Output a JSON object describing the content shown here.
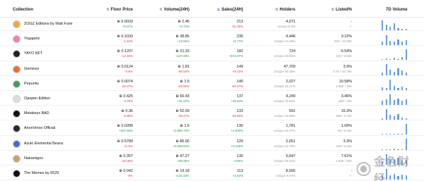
{
  "header": {
    "collection": "Collection",
    "floor_price": "Floor Price",
    "volume": "Volume(24H)",
    "sales": "Sales(24H)",
    "holders": "Holders",
    "listed": "Listed%",
    "volume_7d": "7D Volume"
  },
  "rows": [
    {
      "name": "ZOGZ Editions by Matt Furie",
      "avatar_color": "#f2a93b",
      "floor": "⊕ 0.0033",
      "floor_change": "+9.67%",
      "floor_dir": "up",
      "volume": "⊕ 2.45",
      "volume_change": "+2.74%",
      "volume_dir": "up",
      "sales": "213",
      "sales_change": "-51.49%",
      "sales_dir": "down",
      "holders": "4,071",
      "holders_sub": "Unique 6.3%",
      "listed": "-",
      "listed_sub": "-/-",
      "spark": [
        0.9,
        0.5,
        0.3,
        0.6,
        0.2,
        0.15,
        0.1
      ]
    },
    {
      "name": "Yogapetz",
      "avatar_color": "#f07fb3",
      "floor": "⊕ 0.1033",
      "floor_change": "-1.52%",
      "floor_dir": "down",
      "volume": "⊕ 38.85",
      "volume_change": "+13.55%",
      "volume_dir": "up",
      "sales": "235",
      "sales_change": "+6.77%",
      "sales_dir": "up",
      "holders": "4,446",
      "holders_sub": "Unique 44.46%",
      "listed": "3.22%",
      "listed_sub": "325 / 10.09K",
      "spark": [
        0.3,
        0.9,
        0.4,
        0.3,
        0.5,
        0.35,
        0.45
      ]
    },
    {
      "name": "YAYO NFT",
      "avatar_color": "#222222",
      "floor": "⊕ 0.1207",
      "floor_change": "-12.16%",
      "floor_dir": "down",
      "volume": "⊕ 21.33",
      "volume_change": "+427.09%",
      "volume_dir": "up",
      "sales": "182",
      "sales_change": "+574.07%",
      "sales_dir": "up",
      "holders": "724",
      "holders_sub": "Unique 20.62%",
      "listed": "6.54%",
      "listed_sub": "232 / 3.55K",
      "spark": [
        0.1,
        0.15,
        0.1,
        0.2,
        0.1,
        0.3,
        0.95
      ]
    },
    {
      "name": "Gemesis",
      "avatar_color": "#f36a2b",
      "floor": "⊕ 0.0124",
      "floor_change": "-0.8%",
      "floor_dir": "down",
      "volume": "⊕ 1.81",
      "volume_change": "-89.53%",
      "volume_dir": "down",
      "sales": "149",
      "sales_change": "-79.42%",
      "sales_dir": "down",
      "holders": "47,709",
      "holders_sub": "Unique 50.35%",
      "listed": "3.9%",
      "listed_sub": "3.7K / 94.75K",
      "spark": [
        0.2,
        0.95,
        0.5,
        0.3,
        0.6,
        0.4,
        0.2
      ]
    },
    {
      "name": "Pepunks",
      "avatar_color": "#3e9e5a",
      "floor": "⊕ 0.0074",
      "floor_change": "-20.27%",
      "floor_dir": "down",
      "volume": "⊕ 1.5",
      "volume_change": "-83.55%",
      "volume_dir": "down",
      "sales": "140",
      "sales_change": "-82.57%",
      "sales_dir": "down",
      "holders": "2,027",
      "holders_sub": "Unique 20.27%",
      "listed": "19.58%",
      "listed_sub": "1.96K / 10K",
      "spark": [
        0.25,
        0.2,
        0.95,
        0.35,
        0.15,
        0.3,
        0.2
      ]
    },
    {
      "name": "Opepen Edition",
      "avatar_color": "#dddddd",
      "floor": "⊕ 0.425",
      "floor_change": "-3.29%",
      "floor_dir": "down",
      "volume": "⊕ 66.43",
      "volume_change": "+31.22%",
      "volume_dir": "up",
      "sales": "137",
      "sales_change": "+33.64%",
      "sales_dir": "up",
      "holders": "4,249",
      "holders_sub": "Unique 26.56%",
      "listed": "3.46%",
      "listed_sub": "553 / 16K",
      "spark": [
        0.4,
        0.5,
        0.95,
        0.45,
        0.55,
        0.4,
        0.5
      ]
    },
    {
      "name": "Metakeys BAD",
      "avatar_color": "#111111",
      "floor": "⊕ 0.36",
      "floor_change": "-9.88%",
      "floor_dir": "down",
      "volume": "⊕ 52.09",
      "volume_change": "-39.27%",
      "volume_dir": "down",
      "sales": "133",
      "sales_change": "-40.93%",
      "sales_dir": "down",
      "holders": "591",
      "holders_sub": "Unique 15.88%",
      "listed": "15.3%",
      "listed_sub": "569 / 3.72K",
      "spark": [
        0.15,
        0.95,
        0.45,
        0.3,
        0.5,
        0.2,
        0.15
      ]
    },
    {
      "name": "AnonVerse Official",
      "avatar_color": "#2a2a2a",
      "floor": "⊕ 0.0289",
      "floor_change": "+287.65%",
      "floor_dir": "up",
      "volume": "⊕ 1.5",
      "volume_change": "+3,965.73%",
      "volume_dir": "up",
      "sales": "130",
      "sales_change": "+2,500%",
      "sales_dir": "up",
      "holders": "1,781",
      "holders_sub": "Unique 28.27%",
      "listed": "1.09%",
      "listed_sub": "69 / 6.33K",
      "spark": [
        0.05,
        0.05,
        0.05,
        0.05,
        0.05,
        0.05,
        0.95
      ]
    },
    {
      "name": "Azuki Elemental Beans",
      "avatar_color": "#3f6ed8",
      "floor": "⊕ 0.5789",
      "floor_change": "-11.6%",
      "floor_dir": "down",
      "volume": "⊕ 86.06",
      "volume_change": "+3,268.64%",
      "volume_dir": "up",
      "sales": "129",
      "sales_change": "+3,125%",
      "sales_dir": "up",
      "holders": "2,051",
      "holders_sub": "Unique 32.79%",
      "listed": "3.3%",
      "listed_sub": "209 / 6.33K",
      "spark": [
        0.05,
        0.05,
        0.05,
        0.1,
        0.05,
        0.05,
        0.95
      ]
    },
    {
      "name": "Nakamigos",
      "avatar_color": "#c9a36a",
      "floor": "⊕ 0.357",
      "floor_change": "-10.08%",
      "floor_dir": "down",
      "volume": "⊕ 47.27",
      "volume_change": "+80.05%",
      "volume_dir": "up",
      "sales": "130",
      "sales_change": "+100%",
      "sales_dir": "up",
      "holders": "5,647",
      "holders_sub": "Unique 28.24%",
      "listed": "7.61%",
      "listed_sub": "1.52K / 20K",
      "spark": [
        0.3,
        0.95,
        0.5,
        0.4,
        0.6,
        0.35,
        0.45
      ]
    },
    {
      "name": "The Memes by 6529",
      "avatar_color": "#111111",
      "floor": "⊕ 0.042",
      "floor_change": "-8%",
      "floor_dir": "down",
      "volume": "⊕ 19.18",
      "volume_change": "+133.42%",
      "volume_dir": "up",
      "sales": "113",
      "sales_change": "+3.64%",
      "sales_dir": "up",
      "holders": "8,565",
      "holders_sub": "Unique 9.07%",
      "listed": "-",
      "listed_sub": "-/-",
      "spark": [
        0.35,
        0.95,
        0.4,
        0.5,
        0.3,
        0.45,
        0.4
      ]
    }
  ],
  "watermark": {
    "text": "金色财经"
  },
  "colors": {
    "up": "#17a34a",
    "down": "#e23b3b",
    "bar": "#6a9de6",
    "active_sort": "#2b6fd6"
  }
}
